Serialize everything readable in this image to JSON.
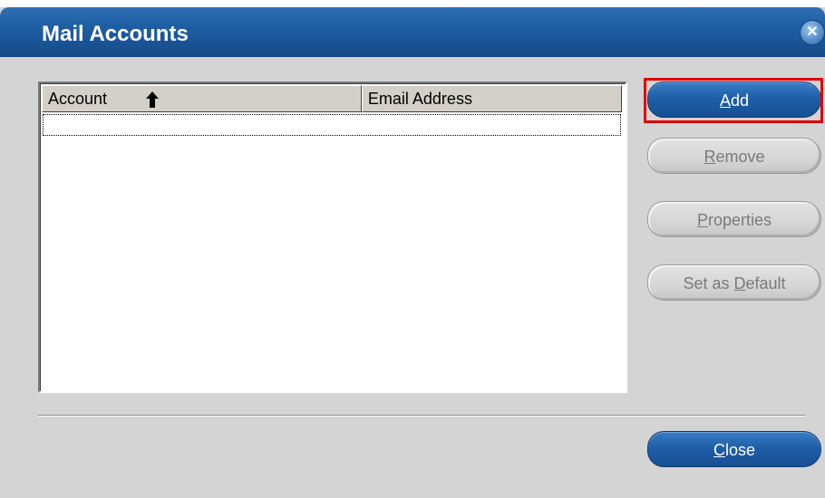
{
  "window": {
    "title": "Mail Accounts",
    "close_glyph": "✕"
  },
  "list": {
    "columns": [
      "Account",
      "Email Address"
    ],
    "sort_column": "Account",
    "sort_direction": "ascending",
    "rows": []
  },
  "buttons": {
    "add": {
      "pre": "",
      "mnemonic": "A",
      "post": "dd",
      "enabled": true
    },
    "remove": {
      "pre": "",
      "mnemonic": "R",
      "post": "emove",
      "enabled": false
    },
    "properties": {
      "pre": "",
      "mnemonic": "P",
      "post": "roperties",
      "enabled": false
    },
    "set_default": {
      "pre": "Set as ",
      "mnemonic": "D",
      "post": "efault",
      "enabled": false
    },
    "close": {
      "pre": "",
      "mnemonic": "C",
      "post": "lose",
      "enabled": true
    }
  },
  "colors": {
    "titlebar": "#1f5fa4",
    "highlight": "#e00000"
  }
}
